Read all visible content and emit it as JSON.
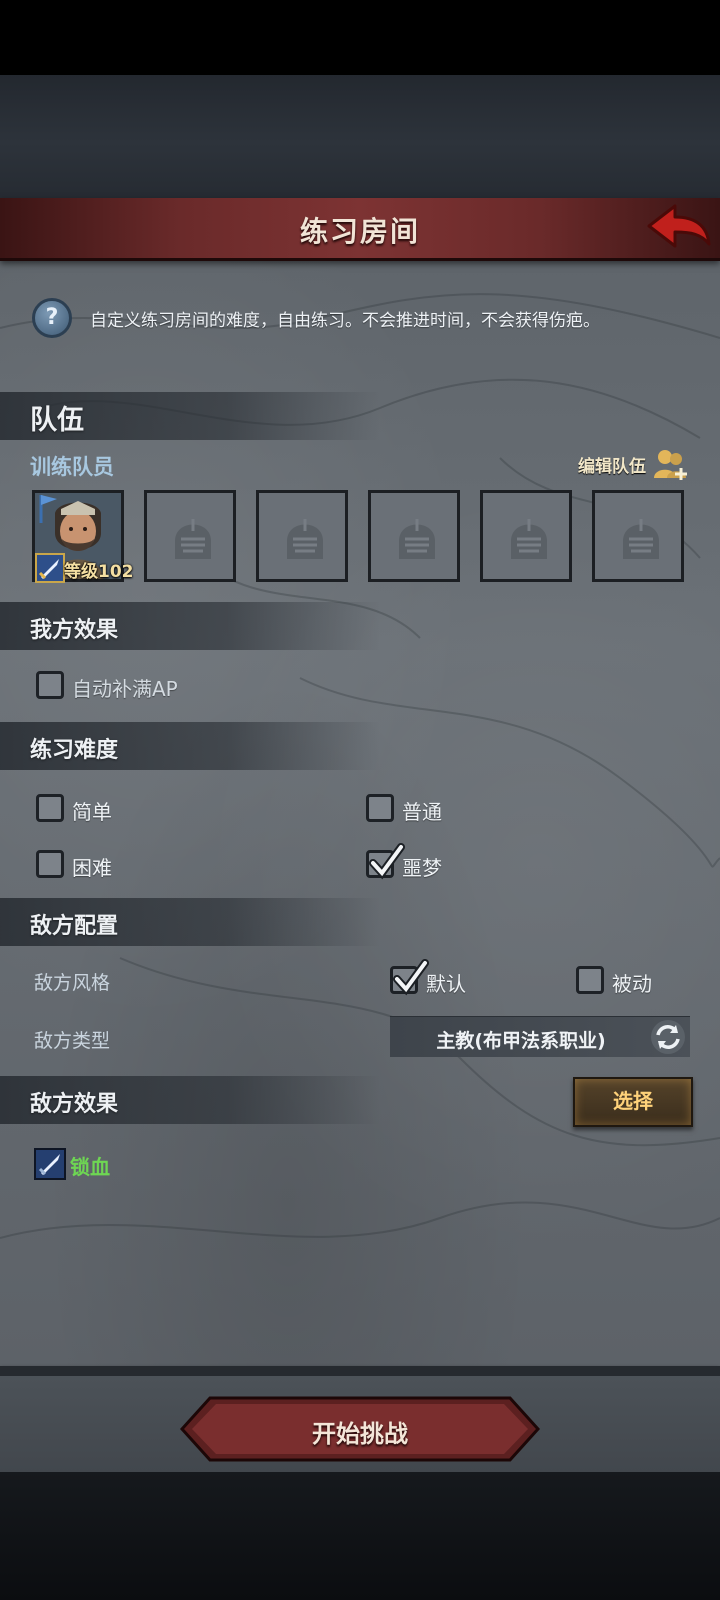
{
  "header": {
    "title": "练习房间"
  },
  "help": {
    "text": "自定义练习房间的难度，自由练习。不会推进时间，不会获得伤疤。"
  },
  "team": {
    "section_title": "队伍",
    "members_label": "训练队员",
    "edit_label": "编辑队伍",
    "hero_level": "等级102"
  },
  "our_effects": {
    "section_title": "我方效果",
    "auto_ap": {
      "label": "自动补满AP",
      "checked": false
    }
  },
  "difficulty": {
    "section_title": "练习难度",
    "options": [
      {
        "label": "简单",
        "checked": false
      },
      {
        "label": "普通",
        "checked": false
      },
      {
        "label": "困难",
        "checked": false
      },
      {
        "label": "噩梦",
        "checked": true
      }
    ]
  },
  "enemy_config": {
    "section_title": "敌方配置",
    "style_label": "敌方风格",
    "style_options": [
      {
        "label": "默认",
        "checked": true
      },
      {
        "label": "被动",
        "checked": false
      }
    ],
    "type_label": "敌方类型",
    "type_value": "主教(布甲法系职业)"
  },
  "enemy_effects": {
    "section_title": "敌方效果",
    "select_label": "选择",
    "effect": "锁血"
  },
  "start_button": "开始挑战",
  "colors": {
    "accent_red": "#7d3333",
    "effect_green": "#6ed653",
    "select_gold": "#ffd27a"
  }
}
